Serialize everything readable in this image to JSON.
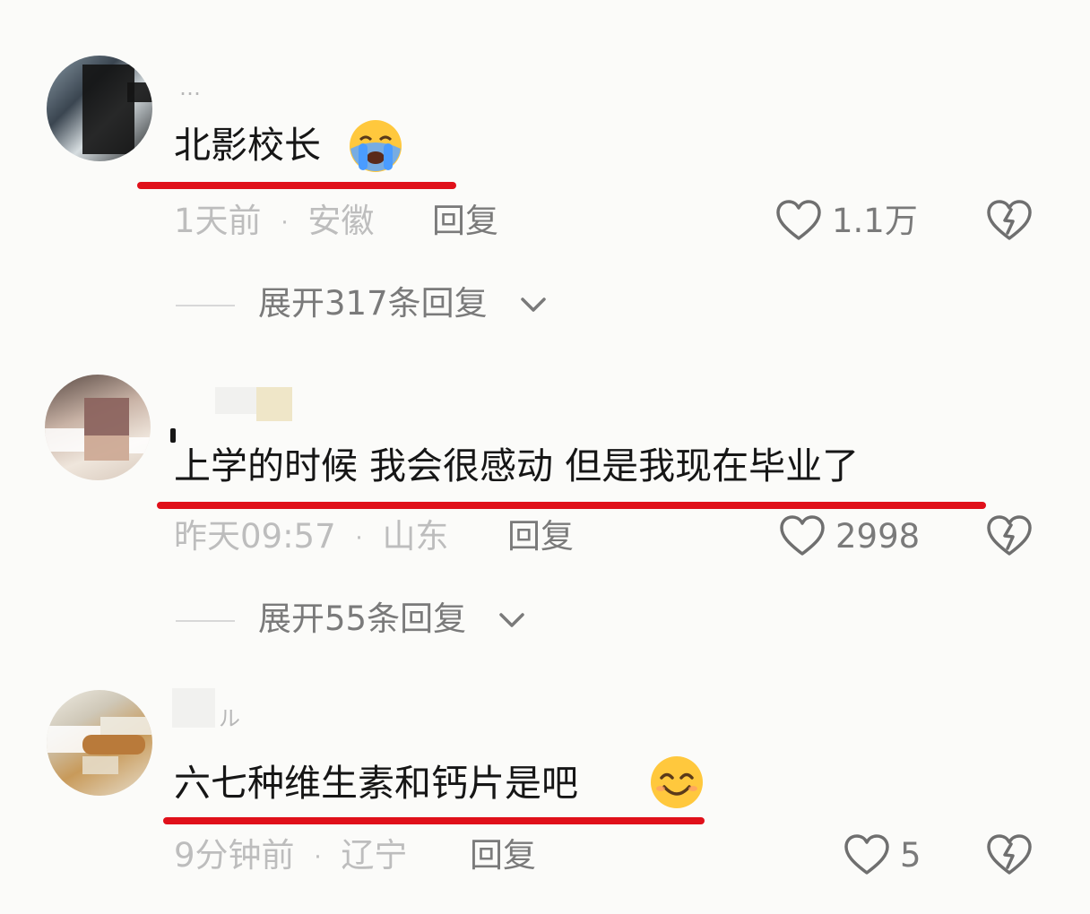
{
  "comments": [
    {
      "nickname_fragment": "…",
      "text": "北影校长",
      "emoji": "crying-face",
      "time": "1天前",
      "separator": "·",
      "location": "安徽",
      "reply_label": "回复",
      "likes": "1.1万",
      "expand_label": "展开317条回复"
    },
    {
      "nickname_fragment": "",
      "text": "上学的时候 我会很感动 但是我现在毕业了",
      "emoji": "",
      "time": "昨天09:57",
      "separator": "·",
      "location": "山东",
      "reply_label": "回复",
      "likes": "2998",
      "expand_label": "展开55条回复"
    },
    {
      "nickname_fragment": "ル",
      "text": "六七种维生素和钙片是吧",
      "emoji": "smiling-face",
      "time": "9分钟前",
      "separator": "·",
      "location": "辽宁",
      "reply_label": "回复",
      "likes": "5",
      "expand_label": ""
    }
  ],
  "colors": {
    "underline": "#e0101a",
    "text": "#161616",
    "meta": "#bdbdbd",
    "action": "#7a7a7a",
    "background": "#fbfbf9"
  }
}
